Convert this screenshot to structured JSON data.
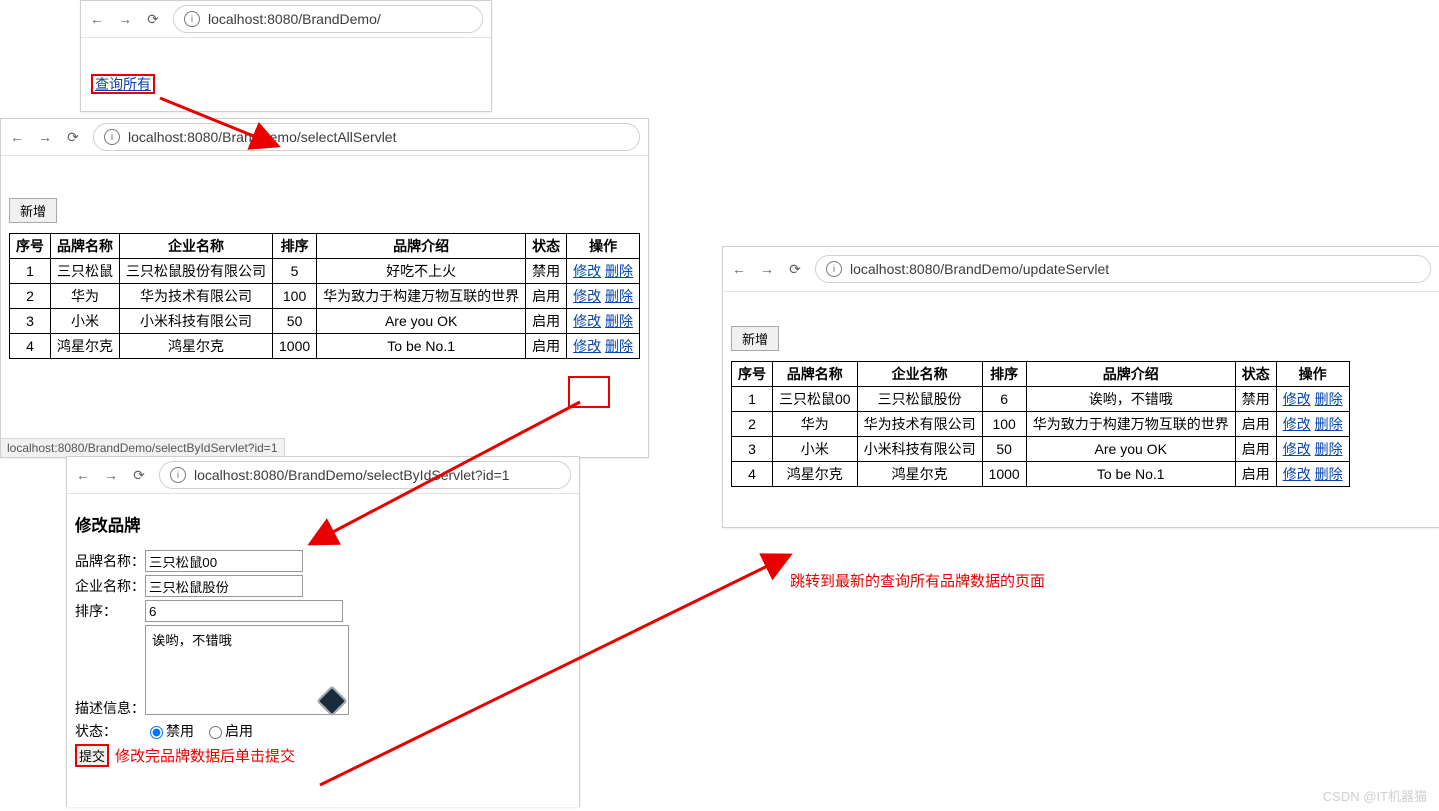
{
  "watermark": "CSDN @IT机器猫",
  "pane1": {
    "url": "localhost:8080/BrandDemo/",
    "link": "查询所有"
  },
  "pane2": {
    "url": "localhost:8080/BrandDemo/selectAllServlet",
    "add_btn": "新增",
    "status_text": "localhost:8080/BrandDemo/selectByIdServlet?id=1",
    "headers": {
      "id": "序号",
      "brand": "品牌名称",
      "company": "企业名称",
      "order": "排序",
      "desc": "品牌介绍",
      "status": "状态",
      "ops": "操作"
    },
    "ops": {
      "edit": "修改",
      "del": "删除"
    },
    "rows": [
      {
        "id": "1",
        "brand": "三只松鼠",
        "company": "三只松鼠股份有限公司",
        "order": "5",
        "desc": "好吃不上火",
        "status": "禁用"
      },
      {
        "id": "2",
        "brand": "华为",
        "company": "华为技术有限公司",
        "order": "100",
        "desc": "华为致力于构建万物互联的世界",
        "status": "启用"
      },
      {
        "id": "3",
        "brand": "小米",
        "company": "小米科技有限公司",
        "order": "50",
        "desc": "Are you OK",
        "status": "启用"
      },
      {
        "id": "4",
        "brand": "鸿星尔克",
        "company": "鸿星尔克",
        "order": "1000",
        "desc": "To be No.1",
        "status": "启用"
      }
    ]
  },
  "pane3": {
    "url": "localhost:8080/BrandDemo/selectByIdServlet?id=1",
    "title": "修改品牌",
    "labels": {
      "brand": "品牌名称：",
      "company": "企业名称：",
      "order": "排序：",
      "desc": "描述信息：",
      "status": "状态：",
      "submit": "提交",
      "opt_disable": "禁用",
      "opt_enable": "启用"
    },
    "values": {
      "brand": "三只松鼠00",
      "company": "三只松鼠股份",
      "order": "6",
      "desc": "诶哟，不错哦"
    }
  },
  "pane4": {
    "url": "localhost:8080/BrandDemo/updateServlet",
    "add_btn": "新增",
    "headers": {
      "id": "序号",
      "brand": "品牌名称",
      "company": "企业名称",
      "order": "排序",
      "desc": "品牌介绍",
      "status": "状态",
      "ops": "操作"
    },
    "ops": {
      "edit": "修改",
      "del": "删除"
    },
    "rows": [
      {
        "id": "1",
        "brand": "三只松鼠00",
        "company": "三只松鼠股份",
        "order": "6",
        "desc": "诶哟，不错哦",
        "status": "禁用"
      },
      {
        "id": "2",
        "brand": "华为",
        "company": "华为技术有限公司",
        "order": "100",
        "desc": "华为致力于构建万物互联的世界",
        "status": "启用"
      },
      {
        "id": "3",
        "brand": "小米",
        "company": "小米科技有限公司",
        "order": "50",
        "desc": "Are you OK",
        "status": "启用"
      },
      {
        "id": "4",
        "brand": "鸿星尔克",
        "company": "鸿星尔克",
        "order": "1000",
        "desc": "To be No.1",
        "status": "启用"
      }
    ]
  },
  "annot": {
    "submit_note": "修改完品牌数据后单击提交",
    "jump_note": "跳转到最新的查询所有品牌数据的页面"
  }
}
